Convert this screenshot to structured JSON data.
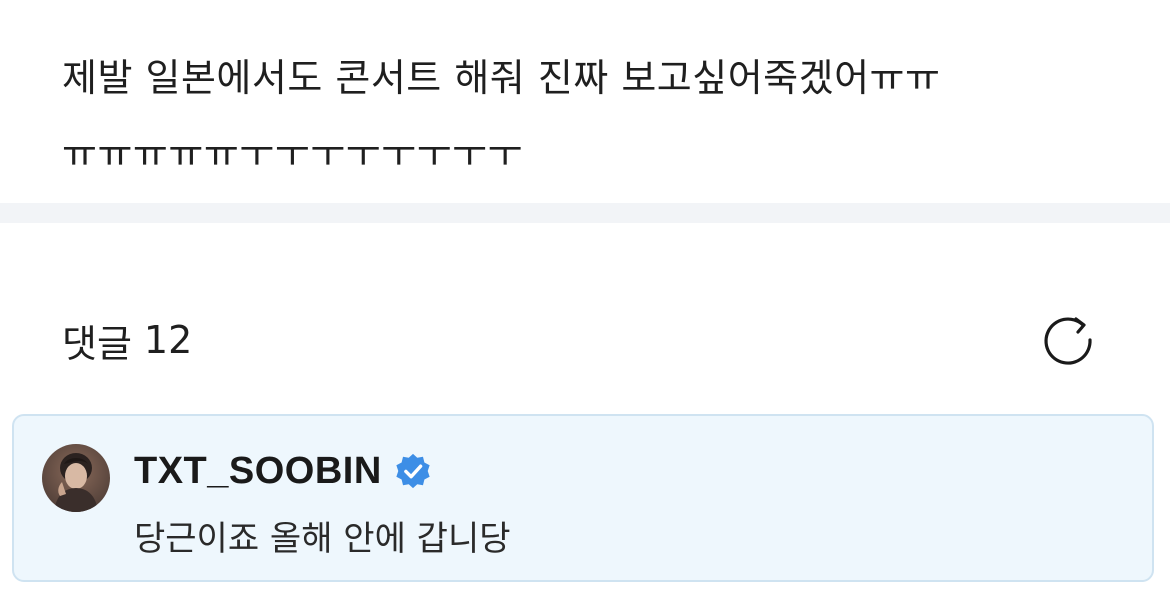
{
  "post": {
    "body": "제발 일본에서도 콘서트 해줘 진짜 보고싶어죽겠어ㅠㅠ\nㅠㅠㅠㅠㅠㅜㅜㅜㅜㅜㅜㅜㅜ"
  },
  "comments": {
    "label": "댓글",
    "count": "12",
    "refresh_icon": "refresh-icon"
  },
  "featured_comment": {
    "author": "TXT_SOOBIN",
    "verified_icon": "verified-badge-icon",
    "text": "당근이죠 올해 안에 갑니당",
    "highlight_color": "#eef7fd",
    "badge_color": "#3d8ee6"
  }
}
